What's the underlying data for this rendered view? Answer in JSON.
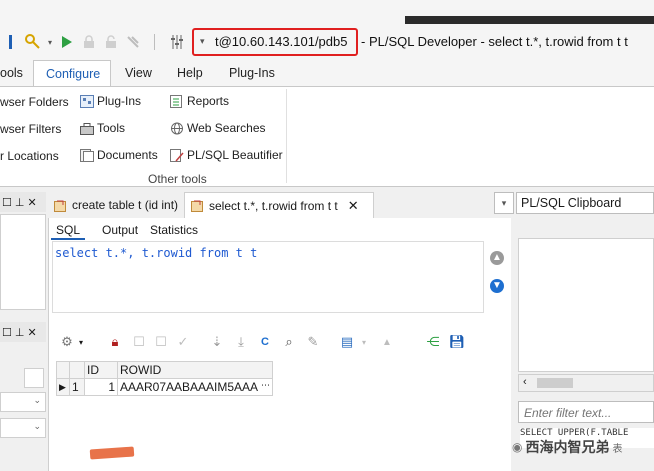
{
  "titlebar": {
    "connection": "t@10.60.143.101/pdb5",
    "title": "- PL/SQL Developer - select t.*, t.rowid from t t"
  },
  "ribbon_tabs": [
    "ools",
    "Configure",
    "View",
    "Help",
    "Plug-Ins"
  ],
  "ribbon": {
    "col1": [
      "wser Folders",
      "wser Filters",
      "r Locations"
    ],
    "col2": [
      "Plug-Ins",
      "Tools",
      "Documents"
    ],
    "col3": [
      "Reports",
      "Web Searches",
      "PL/SQL Beautifier"
    ],
    "group_label": "Other tools"
  },
  "doc_tabs": [
    "create table t (id int)",
    "select t.*, t.rowid from t t"
  ],
  "sql_tabs": [
    "SQL",
    "Output",
    "Statistics"
  ],
  "editor": {
    "kw_select": "select",
    "cols": " t.*, t.rowid ",
    "kw_from": "from",
    "tables": " t t"
  },
  "grid": {
    "columns": [
      "ID",
      "ROWID"
    ],
    "rows": [
      [
        "1",
        "1",
        "AAAR07AABAAAIM5AAA"
      ]
    ]
  },
  "right_pane": {
    "title": "PL/SQL Clipboard",
    "filter_placeholder": "Enter filter text...",
    "sql_preview": "SELECT UPPER(F.TABLE"
  },
  "watermark": "西海内智兄弟",
  "watermark_tail": "表",
  "colors": {
    "accent": "#1e5fb4",
    "highlight": "#e02020",
    "editor_keyword": "#1f5ad1"
  }
}
